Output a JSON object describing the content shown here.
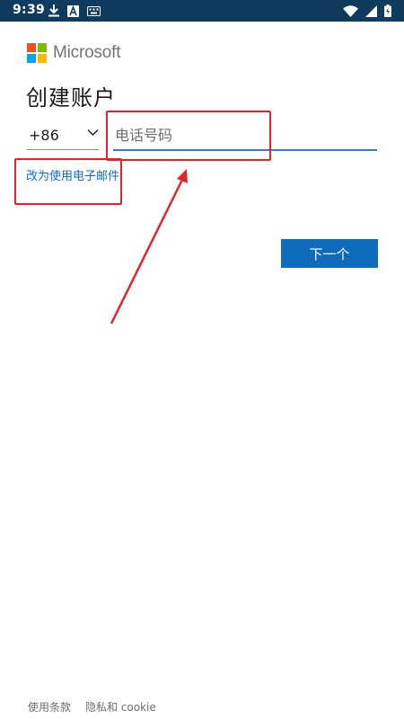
{
  "status_bar": {
    "time": "9:39",
    "left_icons": [
      "download-icon",
      "app-a-icon",
      "keyboard-icon"
    ],
    "right_icons": [
      "wifi-icon",
      "cell-signal-icon",
      "battery-charging-icon"
    ]
  },
  "brand": {
    "name": "Microsoft",
    "logo_colors": [
      "#f25022",
      "#7fba00",
      "#00a4ef",
      "#ffb900"
    ]
  },
  "page": {
    "title": "创建账户"
  },
  "form": {
    "country_code": "+86",
    "phone_placeholder": "电话号码",
    "phone_value": "",
    "switch_to_email": "改为使用电子邮件",
    "next_button": "下一个"
  },
  "footer": {
    "terms": "使用条款",
    "privacy": "隐私和 cookie"
  },
  "colors": {
    "status_bar_bg": "#0f3b5e",
    "accent": "#0f6cbd",
    "annotation": "#e3242b"
  }
}
